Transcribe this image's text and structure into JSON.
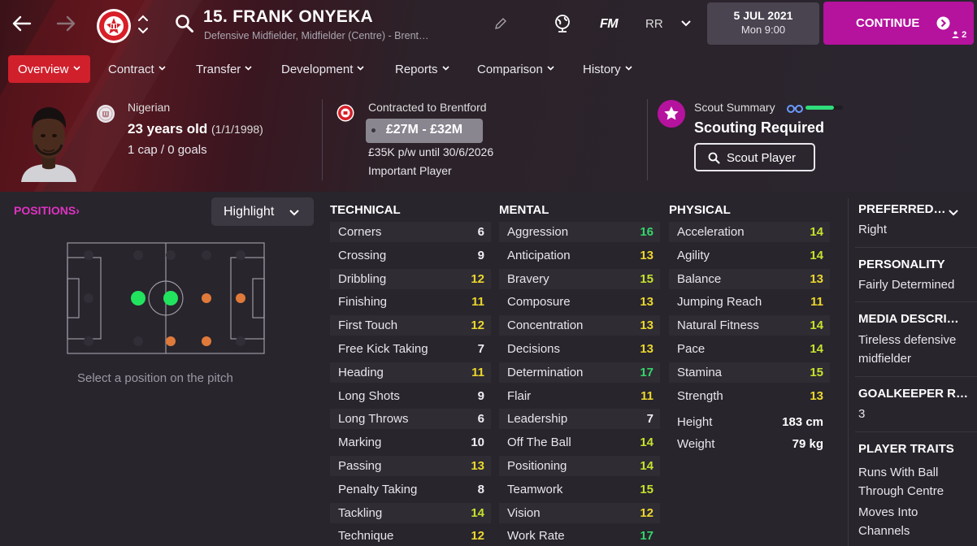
{
  "header": {
    "player_name": "15. FRANK ONYEKA",
    "player_sub": "Defensive Midfielder, Midfielder (Centre) - Brent…",
    "fm_label": "FM",
    "rr_label": "RR",
    "date": "5 JUL 2021",
    "time": "Mon 9:00",
    "continue_label": "CONTINUE",
    "user_count": "2"
  },
  "tabs": [
    {
      "label": "Overview",
      "active": true
    },
    {
      "label": "Contract"
    },
    {
      "label": "Transfer"
    },
    {
      "label": "Development"
    },
    {
      "label": "Reports"
    },
    {
      "label": "Comparison"
    },
    {
      "label": "History"
    }
  ],
  "profile": {
    "nationality": "Nigerian",
    "age": "23 years old",
    "dob": "(1/1/1998)",
    "caps": "1 cap / 0 goals",
    "contract": "Contracted to Brentford",
    "value": "£27M - £32M",
    "wage": "£35K p/w until 30/6/2026",
    "status": "Important Player"
  },
  "scout": {
    "label": "Scout Summary",
    "knowledge_fraction": 0.75,
    "value": "Scouting Required",
    "button": "Scout Player"
  },
  "positions": {
    "title": "POSITIONS",
    "arrow": "›",
    "highlight": "Highlight",
    "hint": "Select a position on the pitch"
  },
  "technical": {
    "title": "TECHNICAL",
    "items": [
      {
        "name": "Corners",
        "value": "6"
      },
      {
        "name": "Crossing",
        "value": "9"
      },
      {
        "name": "Dribbling",
        "value": "12"
      },
      {
        "name": "Finishing",
        "value": "11"
      },
      {
        "name": "First Touch",
        "value": "12"
      },
      {
        "name": "Free Kick Taking",
        "value": "7"
      },
      {
        "name": "Heading",
        "value": "11"
      },
      {
        "name": "Long Shots",
        "value": "9"
      },
      {
        "name": "Long Throws",
        "value": "6"
      },
      {
        "name": "Marking",
        "value": "10"
      },
      {
        "name": "Passing",
        "value": "13"
      },
      {
        "name": "Penalty Taking",
        "value": "8"
      },
      {
        "name": "Tackling",
        "value": "14"
      },
      {
        "name": "Technique",
        "value": "12"
      }
    ]
  },
  "mental": {
    "title": "MENTAL",
    "items": [
      {
        "name": "Aggression",
        "value": "16"
      },
      {
        "name": "Anticipation",
        "value": "13"
      },
      {
        "name": "Bravery",
        "value": "15"
      },
      {
        "name": "Composure",
        "value": "13"
      },
      {
        "name": "Concentration",
        "value": "13"
      },
      {
        "name": "Decisions",
        "value": "13"
      },
      {
        "name": "Determination",
        "value": "17"
      },
      {
        "name": "Flair",
        "value": "11"
      },
      {
        "name": "Leadership",
        "value": "7"
      },
      {
        "name": "Off The Ball",
        "value": "14"
      },
      {
        "name": "Positioning",
        "value": "14"
      },
      {
        "name": "Teamwork",
        "value": "15"
      },
      {
        "name": "Vision",
        "value": "12"
      },
      {
        "name": "Work Rate",
        "value": "17"
      }
    ]
  },
  "physical": {
    "title": "PHYSICAL",
    "items": [
      {
        "name": "Acceleration",
        "value": "14"
      },
      {
        "name": "Agility",
        "value": "14"
      },
      {
        "name": "Balance",
        "value": "13"
      },
      {
        "name": "Jumping Reach",
        "value": "11"
      },
      {
        "name": "Natural Fitness",
        "value": "14"
      },
      {
        "name": "Pace",
        "value": "14"
      },
      {
        "name": "Stamina",
        "value": "15"
      },
      {
        "name": "Strength",
        "value": "13"
      }
    ],
    "height_label": "Height",
    "height": "183 cm",
    "weight_label": "Weight",
    "weight": "79 kg"
  },
  "side": {
    "preferred_foot_title": "PREFERRED…",
    "preferred_foot": "Right",
    "personality_title": "PERSONALITY",
    "personality": "Fairly Determined",
    "media_title": "MEDIA DESCRI…",
    "media_line1": "Tireless defensive",
    "media_line2": "midfielder",
    "gk_title": "GOALKEEPER R…",
    "gk_value": "3",
    "traits_title": "PLAYER TRAITS",
    "trait1_line1": "Runs With Ball",
    "trait1_line2": "Through Centre",
    "trait2_line1": "Moves Into",
    "trait2_line2": "Channels"
  },
  "colors": {
    "accent": "#b5129e",
    "tab_active": "#d0202c",
    "attr_green": "#34d66a",
    "attr_lime": "#c8e22c",
    "attr_yellow": "#ecd82c"
  }
}
